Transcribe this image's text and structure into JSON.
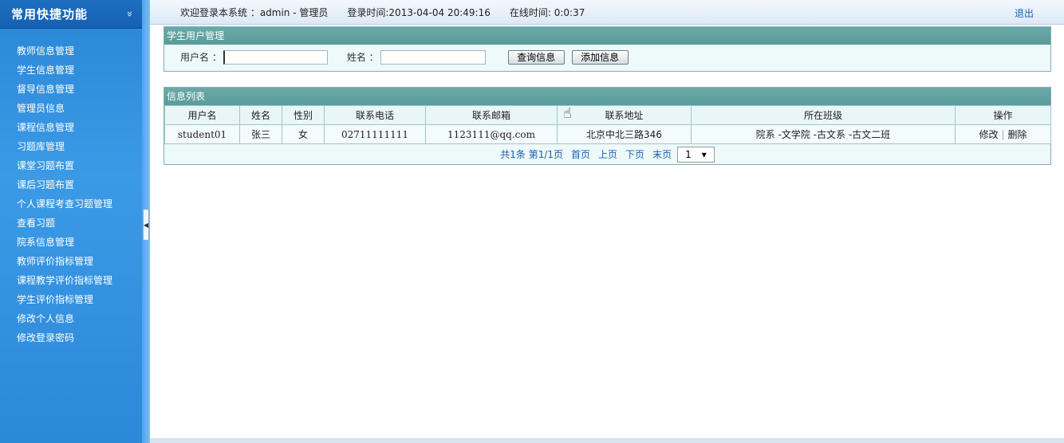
{
  "sidebar": {
    "title": "常用快捷功能",
    "chevron": "»",
    "items": [
      {
        "label": "教师信息管理"
      },
      {
        "label": "学生信息管理"
      },
      {
        "label": "督导信息管理"
      },
      {
        "label": "管理员信息"
      },
      {
        "label": "课程信息管理"
      },
      {
        "label": "习题库管理"
      },
      {
        "label": "课堂习题布置"
      },
      {
        "label": "课后习题布置"
      },
      {
        "label": "个人课程考查习题管理"
      },
      {
        "label": "查看习题"
      },
      {
        "label": "院系信息管理"
      },
      {
        "label": "教师评价指标管理"
      },
      {
        "label": "课程教学评价指标管理"
      },
      {
        "label": "学生评价指标管理"
      },
      {
        "label": "修改个人信息"
      },
      {
        "label": "修改登录密码"
      }
    ],
    "splitter_glyph": "◀"
  },
  "topbar": {
    "welcome": "欢迎登录本系统 ：admin - 管理员",
    "login_time": "登录时间:2013-04-04 20:49:16",
    "online_time": "在线时间: 0:0:37",
    "logout": "退出"
  },
  "search_panel": {
    "title": "学生用户管理",
    "username_label": "用户名 ：",
    "username_value": "",
    "name_label": "姓名 ：",
    "name_value": "",
    "query_button": "查询信息",
    "add_button": "添加信息"
  },
  "list_panel": {
    "title": "信息列表",
    "columns": [
      "用户名",
      "姓名",
      "性别",
      "联系电话",
      "联系邮箱",
      "联系地址",
      "所在班级",
      "操作"
    ],
    "rows": [
      {
        "username": "student01",
        "name": "张三",
        "gender": "女",
        "phone": "02711111111",
        "email": "1123111@qq.com",
        "address": "北京中北三路346",
        "class": "院系 -文学院 -古文系 -古文二班",
        "edit": "修改",
        "sep": "|",
        "delete": "删除"
      }
    ],
    "pager": {
      "summary": "共1条 第1/1页",
      "first": "首页",
      "prev": "上页",
      "next": "下页",
      "last": "末页",
      "page_select": "1",
      "select_arrow": "▾"
    }
  },
  "cursor_icon": "hand-pointer-icon",
  "colors": {
    "sidebar": "#2f8ad8",
    "panel_header": "#5f9f9e",
    "link": "#1b5fb0"
  }
}
